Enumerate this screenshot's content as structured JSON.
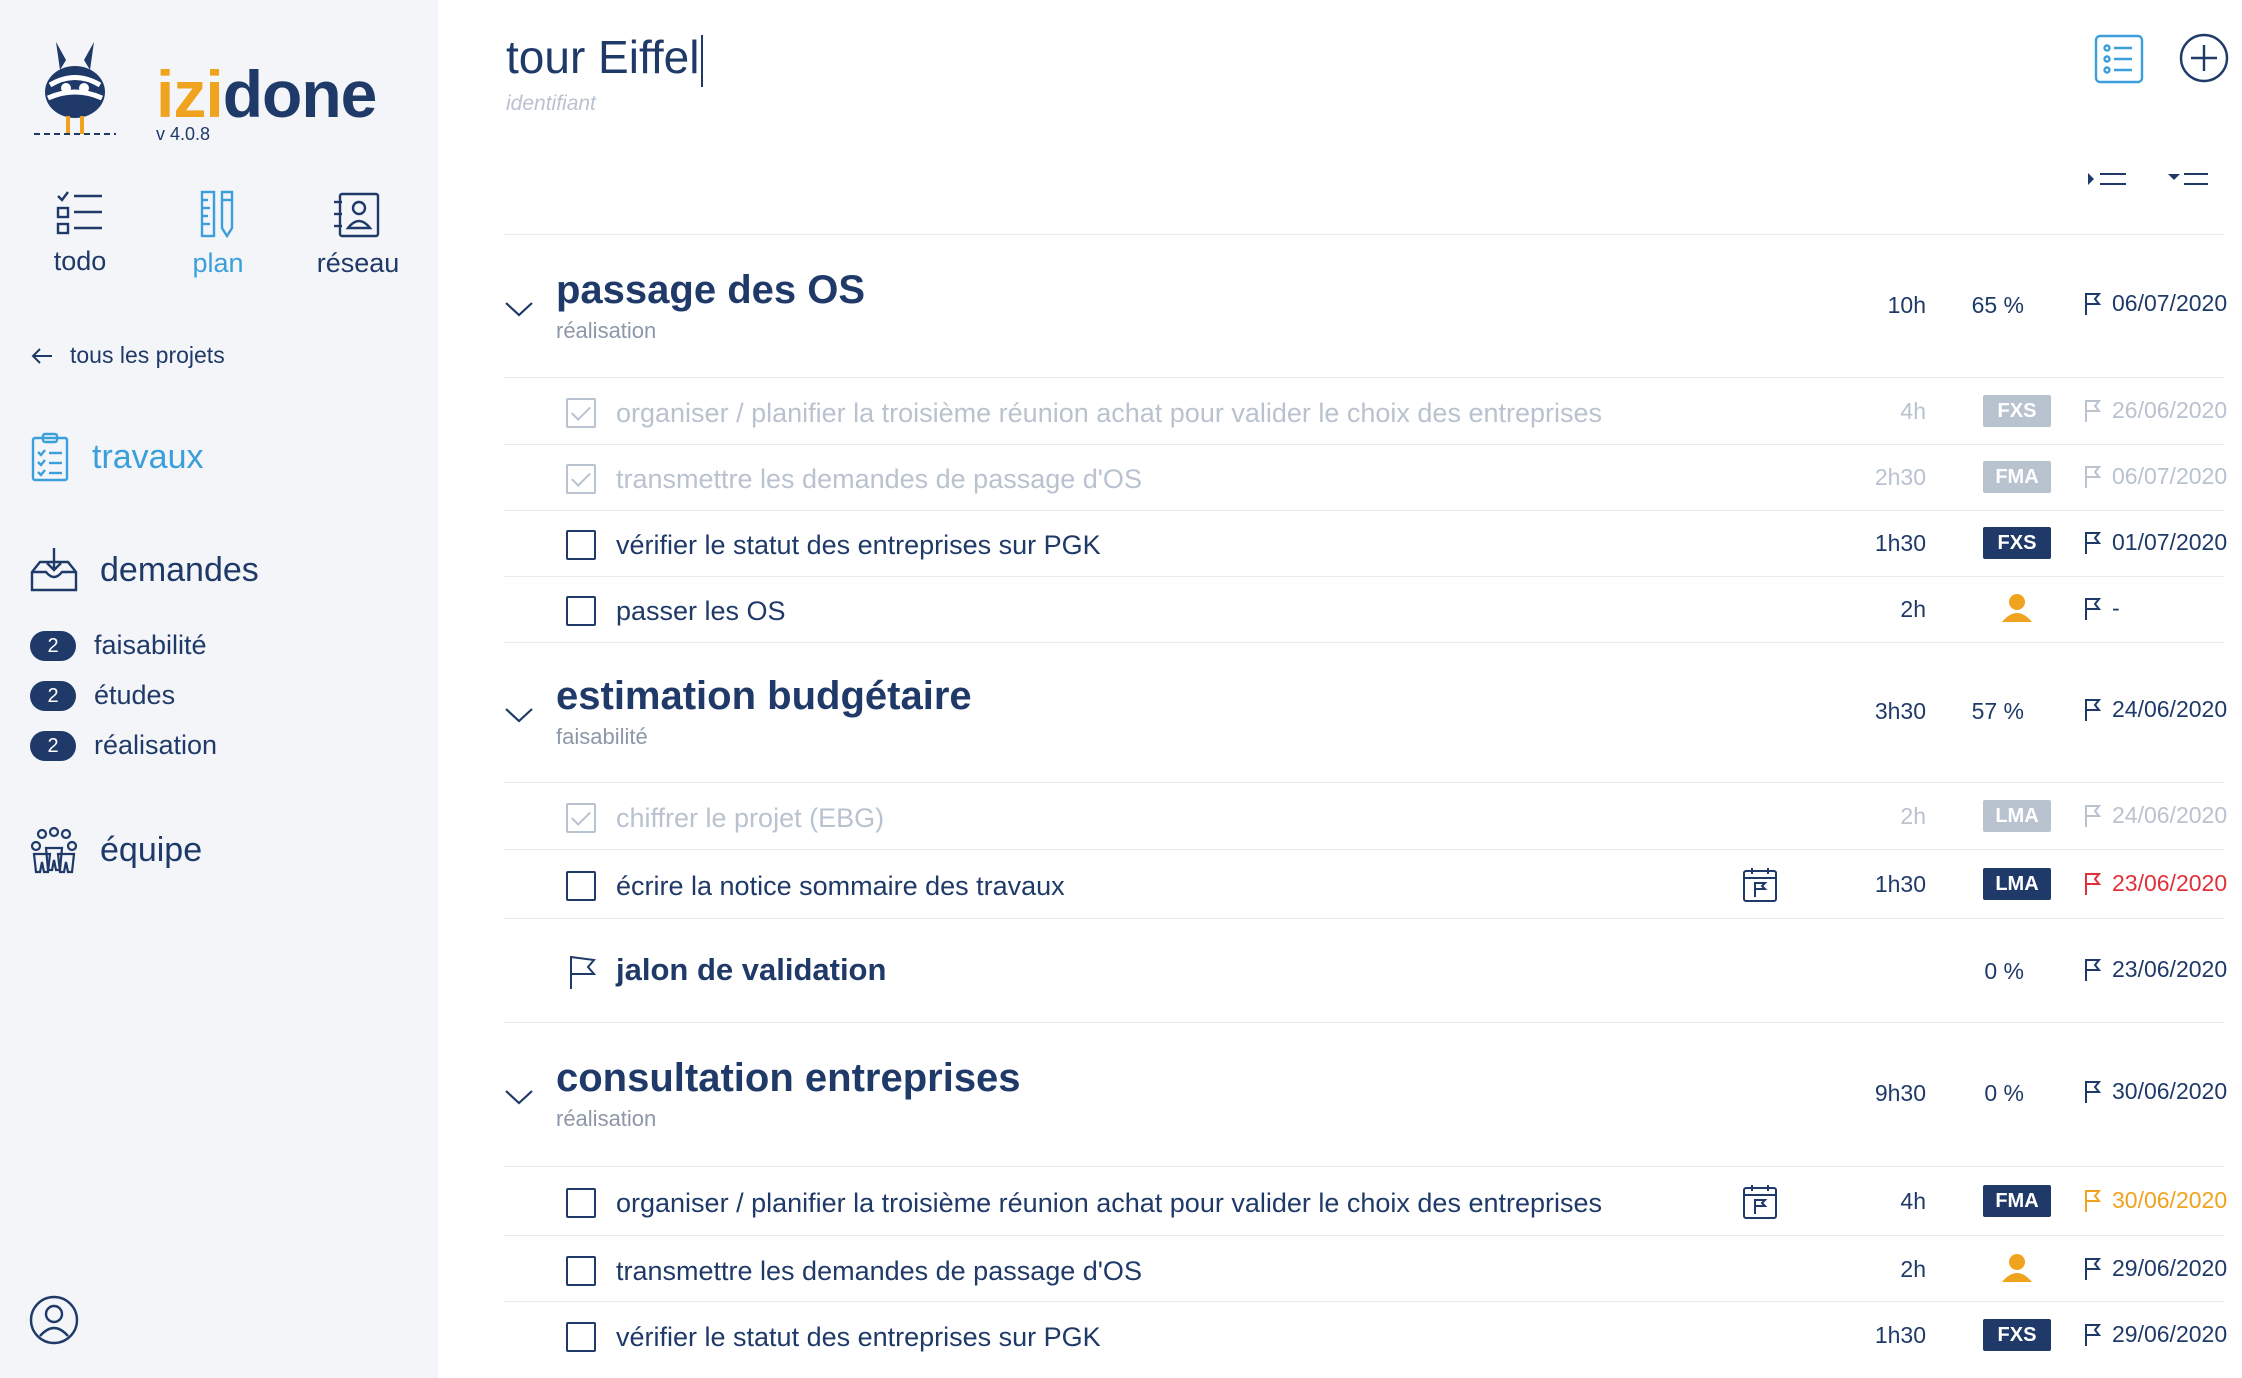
{
  "app": {
    "logo_izi": "izi",
    "logo_done": "done",
    "version": "v 4.0.8",
    "brand_colors": {
      "navy": "#1f3a68",
      "blue": "#3a9fdb",
      "orange": "#f0a31e",
      "grey": "#b9c2cf",
      "red": "#e0303a"
    }
  },
  "modes": [
    {
      "label": "todo",
      "icon": "todo-list-icon"
    },
    {
      "label": "plan",
      "icon": "plan-ruler-icon",
      "active": true
    },
    {
      "label": "réseau",
      "icon": "network-contacts-icon"
    }
  ],
  "sidebar": {
    "back_label": "tous les projets",
    "travaux": "travaux",
    "demandes": "demandes",
    "sub": [
      {
        "count": "2",
        "label": "faisabilité"
      },
      {
        "count": "2",
        "label": "études"
      },
      {
        "count": "2",
        "label": "réalisation"
      }
    ],
    "equipe": "équipe"
  },
  "project": {
    "title": "tour Eiffel",
    "subtitle": "identifiant"
  },
  "groups": [
    {
      "title": "passage des OS",
      "subtitle": "réalisation",
      "duration": "10h",
      "percent": "65 %",
      "date": "06/07/2020",
      "tasks": [
        {
          "label": "organiser / planifier la troisième réunion achat pour valider le choix des entreprises",
          "duration": "4h",
          "tag": "FXS",
          "date": "26/06/2020",
          "done": true
        },
        {
          "label": "transmettre les demandes de passage d'OS",
          "duration": "2h30",
          "tag": "FMA",
          "date": "06/07/2020",
          "done": true
        },
        {
          "label": "vérifier le statut des entreprises sur PGK",
          "duration": "1h30",
          "tag": "FXS",
          "date": "01/07/2020",
          "done": false
        },
        {
          "label": "passer les OS",
          "duration": "2h",
          "tag": "",
          "date": "-",
          "done": false
        }
      ]
    },
    {
      "title": "estimation budgétaire",
      "subtitle": "faisabilité",
      "duration": "3h30",
      "percent": "57 %",
      "date": "24/06/2020",
      "tasks": [
        {
          "label": "chiffrer le projet (EBG)",
          "duration": "2h",
          "tag": "LMA",
          "date": "24/06/2020",
          "done": true
        },
        {
          "label": "écrire la notice sommaire des travaux",
          "duration": "1h30",
          "tag": "LMA",
          "date": "23/06/2020",
          "done": false
        }
      ],
      "milestone": {
        "label": "jalon de validation",
        "percent": "0 %",
        "date": "23/06/2020"
      }
    },
    {
      "title": "consultation entreprises",
      "subtitle": "réalisation",
      "duration": "9h30",
      "percent": "0 %",
      "date": "30/06/2020",
      "tasks": [
        {
          "label": "organiser / planifier la troisième réunion achat pour valider le choix des entreprises",
          "duration": "4h",
          "tag": "FMA",
          "date": "30/06/2020",
          "done": false
        },
        {
          "label": "transmettre les demandes de passage d'OS",
          "duration": "2h",
          "tag": "",
          "date": "29/06/2020",
          "done": false
        },
        {
          "label": "vérifier le statut des entreprises sur PGK",
          "duration": "1h30",
          "tag": "FXS",
          "date": "29/06/2020",
          "done": false
        }
      ]
    }
  ]
}
